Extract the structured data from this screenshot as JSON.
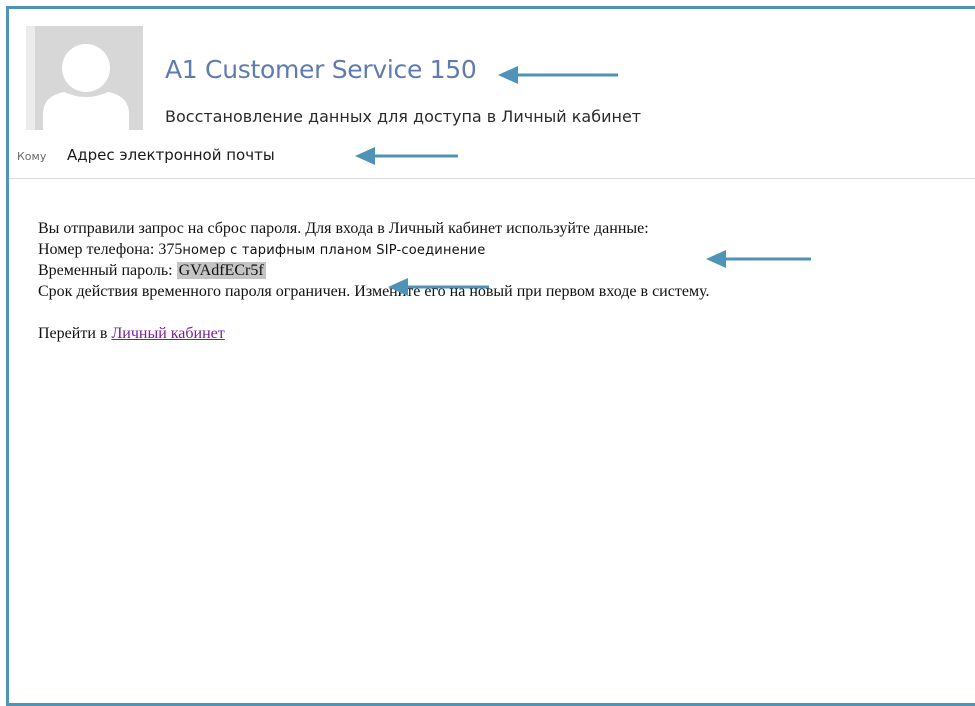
{
  "email": {
    "sender": "A1 Customer Service 150",
    "subject": "Восстановление данных для доступа в Личный кабинет",
    "to_label": "Кому",
    "to_value": "Адрес электронной почты"
  },
  "body": {
    "line1": "Вы отправили запрос на сброс пароля. Для входа в Личный кабинет используйте данные:",
    "phone_label": "Номер телефона: 375",
    "phone_note": "номер с тарифным планом SIP-соединение",
    "password_label": "Временный пароль: ",
    "password_value": "GVAdfECr5f",
    "line4": "Срок действия временного пароля ограничен. Измените его на новый при первом входе в систему.",
    "goto_prefix": "Перейти в ",
    "cabinet_link": "Личный кабинет"
  },
  "colors": {
    "frame_border": "#4f94b6",
    "arrow": "#4f94b6",
    "sender": "#5f7bb0",
    "link": "#7a1e9a",
    "password_highlight": "#c4c4c4"
  },
  "icons": {
    "avatar": "default-person-silhouette",
    "arrows": "left-pointing-annotation-arrow"
  }
}
